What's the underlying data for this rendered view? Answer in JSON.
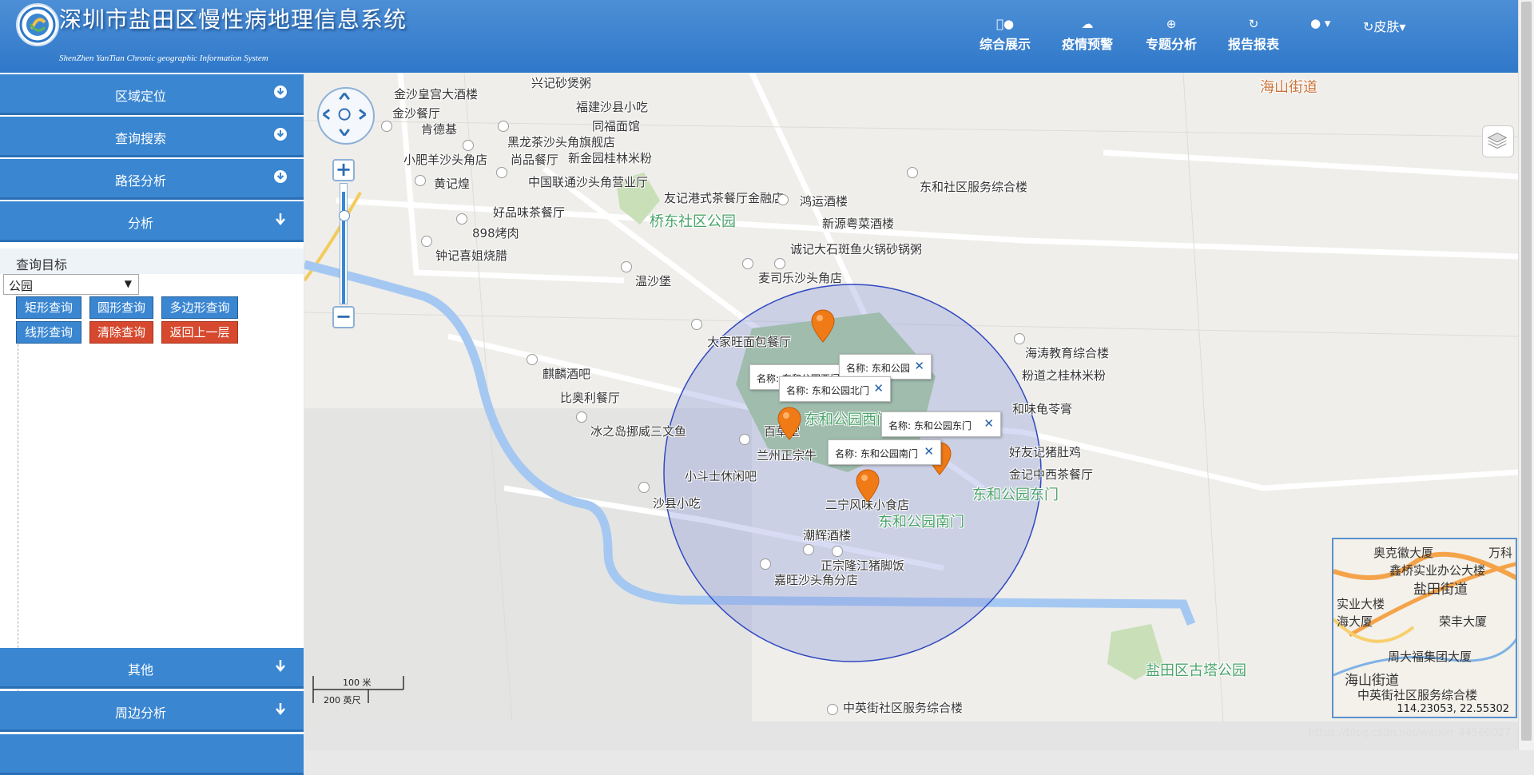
{
  "header": {
    "title": "深圳市盐田区慢性病地理信息系统",
    "subtitle": "ShenZhen YanTian Chronic geographic Information System",
    "nav": [
      {
        "label": "综合展示",
        "icon": "apple-icon"
      },
      {
        "label": "疫情预警",
        "icon": "cloud-icon"
      },
      {
        "label": "专题分析",
        "icon": "download-icon"
      },
      {
        "label": "报告报表",
        "icon": "refresh-icon"
      }
    ],
    "skin_label": "皮肤"
  },
  "panel": {
    "accordions": [
      {
        "label": "区域定位"
      },
      {
        "label": "查询搜索"
      },
      {
        "label": "路径分析"
      },
      {
        "label": "分析"
      },
      {
        "label": "其他"
      },
      {
        "label": "周边分析"
      }
    ],
    "query_target_label": "查询目标",
    "select_value": "公园",
    "buttons": [
      {
        "label": "矩形查询"
      },
      {
        "label": "圆形查询"
      },
      {
        "label": "多边形查询"
      },
      {
        "label": "线形查询"
      },
      {
        "label": "清除查询"
      },
      {
        "label": "返回上一层"
      }
    ]
  },
  "map": {
    "pois": [
      "金沙皇宫大酒楼",
      "金沙餐厅",
      "肯德基",
      "小肥羊沙头角店",
      "黄记煌",
      "兴记砂煲粥",
      "福建沙县小吃",
      "同福面馆",
      "黑龙茶沙头角旗舰店",
      "尚品餐厅",
      "新金园桂林米粉",
      "中国联通沙头角营业厅",
      "友记港式茶餐厅金融店",
      "鸿运酒楼",
      "新源粤菜酒楼",
      "东和社区服务综合楼",
      "好品味茶餐厅",
      "898烤肉",
      "钟记喜姐烧腊",
      "诚记大石斑鱼火锅砂锅粥",
      "麦司乐沙头角店",
      "温沙堡",
      "大家旺面包餐厅",
      "海涛教育综合楼",
      "粉道之桂林米粉",
      "和味龟苓膏",
      "麒麟酒吧",
      "比奥利餐厅",
      "冰之岛挪威三文鱼",
      "百草堂",
      "兰州正宗牛",
      "小斗士休闲吧",
      "好友记猪肚鸡",
      "金记中西茶餐厅",
      "沙县小吃",
      "二宁风味小食店",
      "潮辉酒楼",
      "正宗隆江猪脚饭",
      "嘉旺沙头角分店",
      "中英街社区服务综合楼"
    ],
    "green_labels": [
      "桥东社区公园",
      "东和公园东门",
      "东和公园南门",
      "东和公园西门",
      "盐田区古塔公园"
    ],
    "road_label": "海山街道",
    "popups": [
      "名称: 东和公园西门",
      "名称: 东和公园",
      "名称: 东和公园北门",
      "名称: 东和公园东门",
      "名称: 东和公园南门"
    ],
    "scale": {
      "meters": "100 米",
      "feet": "200 英尺"
    },
    "overview": {
      "labels": [
        "奥克徽大厦",
        "鑫桥实业办公大楼",
        "盐田街道",
        "实业大楼",
        "海大厦",
        "荣丰大厦",
        "周大福集团大厦",
        "海山街道",
        "中英街社区服务综合楼",
        "万科"
      ],
      "coords": "114.23053, 22.55302"
    },
    "watermark": "https://blog.csdn.net/weixin_44560027"
  },
  "colors": {
    "header": "#3a86d1",
    "accordion": "#3a86d1",
    "danger": "#d6492f",
    "buffer": "#8b98dc"
  }
}
